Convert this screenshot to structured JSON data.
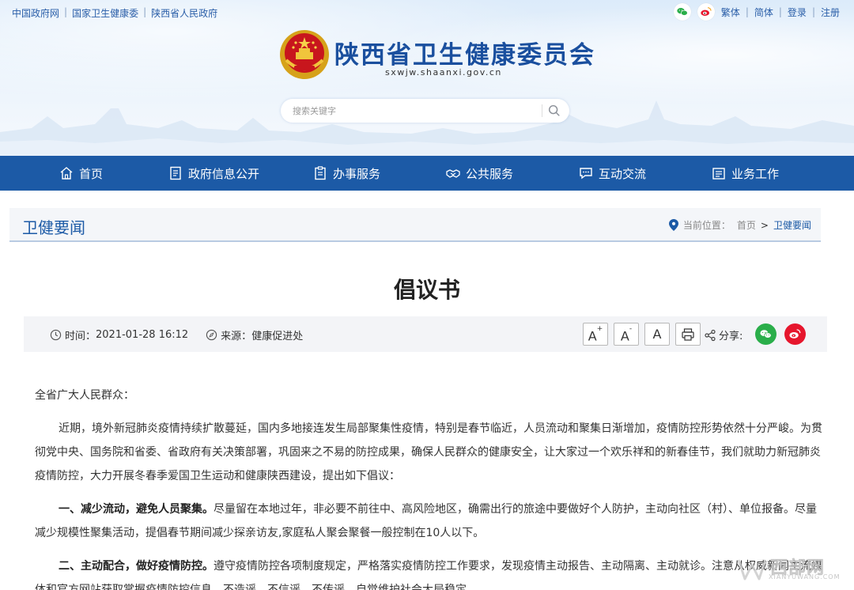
{
  "top_links": [
    "中国政府网",
    "国家卫生健康委",
    "陕西省人民政府"
  ],
  "top_right": {
    "links": [
      "繁体",
      "简体",
      "登录",
      "注册"
    ],
    "icons": [
      "wechat-icon",
      "weibo-icon"
    ]
  },
  "site": {
    "title": "陕西省卫生健康委员会",
    "domain": "sxwjw.shaanxi.gov.cn"
  },
  "search": {
    "placeholder": "搜索关键字"
  },
  "nav": [
    {
      "label": "首页",
      "icon": "home-icon"
    },
    {
      "label": "政府信息公开",
      "icon": "document-icon"
    },
    {
      "label": "办事服务",
      "icon": "clipboard-icon"
    },
    {
      "label": "公共服务",
      "icon": "handshake-icon"
    },
    {
      "label": "互动交流",
      "icon": "chat-icon"
    },
    {
      "label": "业务工作",
      "icon": "briefcase-icon"
    }
  ],
  "section": {
    "title": "卫健要闻",
    "location_label": "当前位置：",
    "crumb_home": "首页",
    "crumb_sep": ">",
    "crumb_current": "卫健要闻"
  },
  "article": {
    "title": "倡议书",
    "time_label": "时间：",
    "time": "2021-01-28 16:12",
    "source_label": "来源：",
    "source": "健康促进处",
    "font_buttons": [
      "A",
      "A",
      "A"
    ],
    "share_label": "分享:",
    "greeting": "全省广大人民群众：",
    "para1": "近期，境外新冠肺炎疫情持续扩散蔓延，国内多地接连发生局部聚集性疫情，特别是春节临近，人员流动和聚集日渐增加，疫情防控形势依然十分严峻。为贯彻党中央、国务院和省委、省政府有关决策部署，巩固来之不易的防控成果，确保人民群众的健康安全，让大家过一个欢乐祥和的新春佳节，我们就助力新冠肺炎疫情防控，大力开展冬春季爱国卫生运动和健康陕西建设，提出如下倡议：",
    "item1_head": "一、减少流动，避免人员聚集。",
    "item1_body": "尽量留在本地过年，非必要不前往中、高风险地区，确需出行的旅途中要做好个人防护，主动向社区（村）、单位报备。尽量减少规模性聚集活动，提倡春节期间减少探亲访友,家庭私人聚会聚餐一般控制在10人以下。",
    "item2_head": "二、主动配合，做好疫情防控。",
    "item2_body": "遵守疫情防控各项制度规定，严格落实疫情防控工作要求，发现疫情主动报告、主动隔离、主动就诊。注意从权威新闻主流媒体和官方网站获取掌握疫情防控信息，不造谣、不信谣、不传谣，自觉维护社会大局稳定。"
  },
  "watermark": {
    "main": "西部网",
    "sub": "XIANYUWANG.COM"
  },
  "colors": {
    "brand_blue": "#1c5aa6",
    "wechat_green": "#2aae4a",
    "weibo_red": "#e6162d"
  }
}
